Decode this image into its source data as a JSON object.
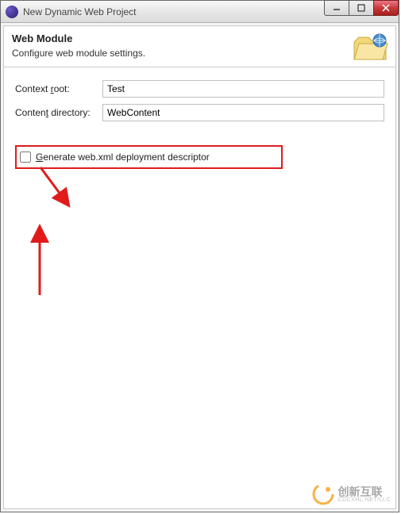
{
  "window": {
    "title": "New Dynamic Web Project"
  },
  "header": {
    "title": "Web Module",
    "subtitle": "Configure web module settings."
  },
  "form": {
    "context_root_label": "Context root:",
    "context_root_value": "Test",
    "content_directory_label": "Content directory:",
    "content_directory_value": "WebContent"
  },
  "checkbox": {
    "label_prefix": "G",
    "label_rest": "enerate web.xml deployment descriptor",
    "checked": false
  },
  "watermark": {
    "text": "创新互联",
    "sub": "CDCXHL.NET/LLC"
  }
}
